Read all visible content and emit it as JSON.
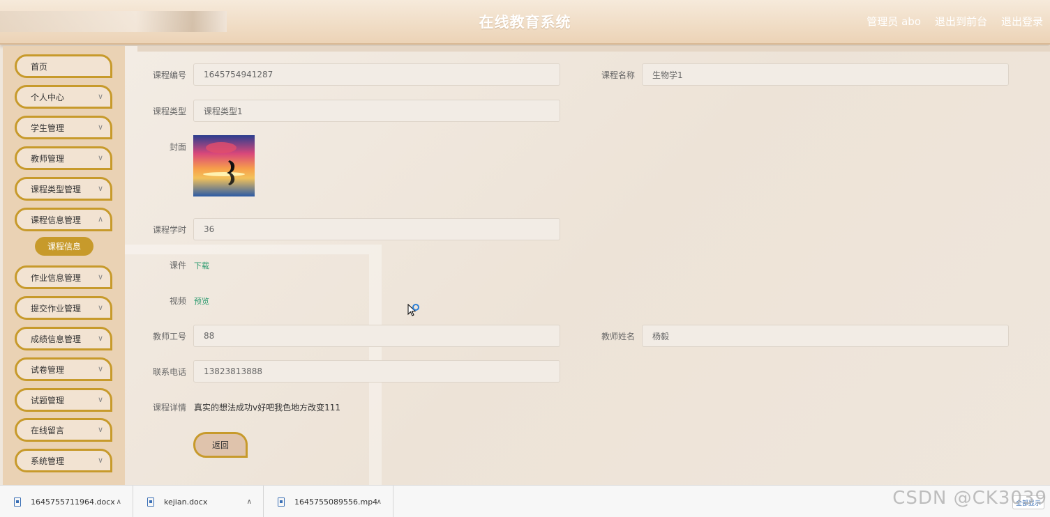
{
  "header": {
    "title": "在线教育系统",
    "user_label": "管理员 abo",
    "front_link": "退出到前台",
    "logout_link": "退出登录"
  },
  "sidebar": {
    "items": [
      {
        "label": "首页"
      },
      {
        "label": "个人中心"
      },
      {
        "label": "学生管理"
      },
      {
        "label": "教师管理"
      },
      {
        "label": "课程类型管理"
      },
      {
        "label": "课程信息管理"
      },
      {
        "label": "作业信息管理"
      },
      {
        "label": "提交作业管理"
      },
      {
        "label": "成绩信息管理"
      },
      {
        "label": "试卷管理"
      },
      {
        "label": "试题管理"
      },
      {
        "label": "在线留言"
      },
      {
        "label": "系统管理"
      }
    ],
    "active_sub": "课程信息"
  },
  "form": {
    "course_no_label": "课程编号",
    "course_no_value": "1645754941287",
    "course_name_label": "课程名称",
    "course_name_value": "生物学1",
    "course_type_label": "课程类型",
    "course_type_value": "课程类型1",
    "cover_label": "封面",
    "hours_label": "课程学时",
    "hours_value": "36",
    "courseware_label": "课件",
    "courseware_link": "下载",
    "video_label": "视频",
    "video_link": "预览",
    "teacher_no_label": "教师工号",
    "teacher_no_value": "88",
    "teacher_name_label": "教师姓名",
    "teacher_name_value": "杨毅",
    "phone_label": "联系电话",
    "phone_value": "13823813888",
    "detail_label": "课程详情",
    "detail_value": "真实的想法成功v好吧我色地方改变111",
    "back_button": "返回"
  },
  "downloads": [
    {
      "name": "1645755711964.docx"
    },
    {
      "name": "kejian.docx"
    },
    {
      "name": "1645755089556.mp4"
    }
  ],
  "watermark": "CSDN @CK3039",
  "show_all": "全部显示"
}
